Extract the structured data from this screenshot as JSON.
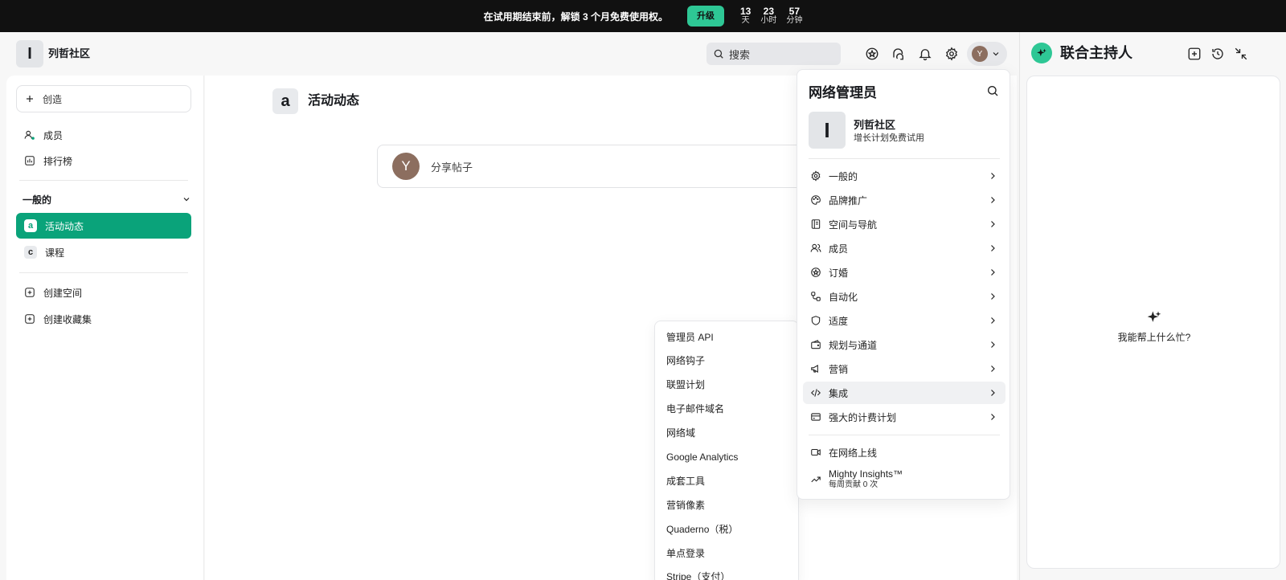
{
  "banner": {
    "text": "在试用期结束前，解锁 3 个月免费使用权。",
    "upgrade_label": "升级",
    "countdown": [
      {
        "value": "13",
        "unit": "天"
      },
      {
        "value": "23",
        "unit": "小时"
      },
      {
        "value": "57",
        "unit": "分钟"
      }
    ]
  },
  "header": {
    "community_initial": "I",
    "community_name": "列哲社区",
    "search_label": "搜索",
    "avatar_initial": "Y"
  },
  "sidebar": {
    "create_label": "创造",
    "items": [
      {
        "label": "成员",
        "icon": "members-icon"
      },
      {
        "label": "排行榜",
        "icon": "leaderboard-icon"
      }
    ],
    "section_title": "一般的",
    "spaces": [
      {
        "badge": "a",
        "label": "活动动态",
        "active": true
      },
      {
        "badge": "c",
        "label": "课程",
        "active": false
      }
    ],
    "actions": [
      {
        "label": "创建空间"
      },
      {
        "label": "创建收藏集"
      }
    ],
    "accent_color": "#0aa37a"
  },
  "main": {
    "feed_badge": "a",
    "feed_title": "活动动态",
    "composer_avatar": "Y",
    "composer_placeholder": "分享帖子"
  },
  "submenu": {
    "items": [
      "管理员 API",
      "网络钩子",
      "联盟计划",
      "电子邮件域名",
      "网络域",
      "Google Analytics",
      "成套工具",
      "营销像素",
      "Quaderno（税）",
      "单点登录",
      "Stripe（支付）"
    ]
  },
  "admin_menu": {
    "title": "网络管理员",
    "community_initial": "I",
    "community_name": "列哲社区",
    "community_plan": "增长计划免费试用",
    "items": [
      {
        "label": "一般的",
        "icon": "gear-icon"
      },
      {
        "label": "品牌推广",
        "icon": "palette-icon"
      },
      {
        "label": "空间与导航",
        "icon": "book-icon"
      },
      {
        "label": "成员",
        "icon": "members-icon"
      },
      {
        "label": "订婚",
        "icon": "star-badge-icon"
      },
      {
        "label": "自动化",
        "icon": "workflow-icon"
      },
      {
        "label": "适度",
        "icon": "shield-icon"
      },
      {
        "label": "规划与通道",
        "icon": "wallet-icon"
      },
      {
        "label": "营销",
        "icon": "megaphone-icon"
      },
      {
        "label": "集成",
        "icon": "code-icon"
      },
      {
        "label": "强大的计费计划",
        "icon": "credit-card-icon"
      }
    ],
    "live_label": "在网络上线",
    "insights_title": "Mighty Insights™",
    "insights_sub": "每周贡献 0 次"
  },
  "cohost": {
    "title": "联合主持人",
    "help_text": "我能帮上什么忙?"
  }
}
